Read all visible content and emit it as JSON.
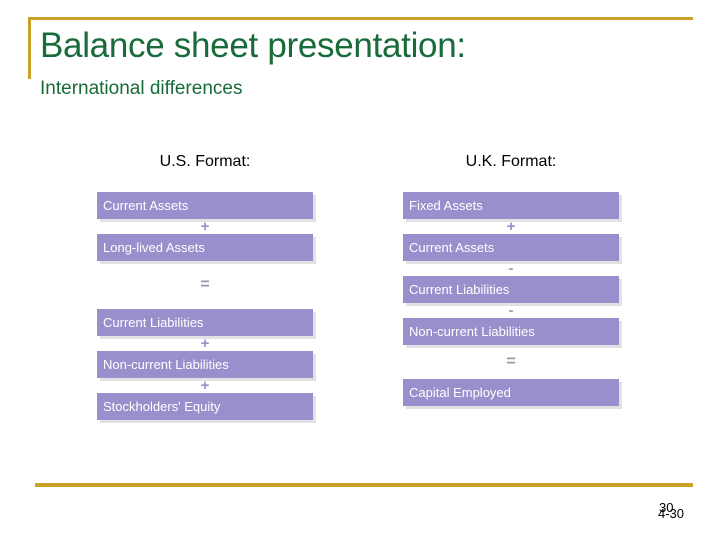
{
  "slide": {
    "title": "Balance sheet presentation:",
    "subtitle": "International differences",
    "accent_gold": "#C9A227",
    "title_green": "#186B3A",
    "bar_purple": "#9A8FCC",
    "bar_text_color": "#FFFFFF"
  },
  "columns": [
    {
      "heading": "U.S. Format:",
      "rows": [
        {
          "kind": "bar",
          "label": "Current Assets"
        },
        {
          "kind": "operator",
          "symbol": "+"
        },
        {
          "kind": "bar",
          "label": "Long-lived Assets"
        },
        {
          "kind": "operator",
          "symbol": "="
        },
        {
          "kind": "bar",
          "label": "Current Liabilities"
        },
        {
          "kind": "operator",
          "symbol": "+"
        },
        {
          "kind": "bar",
          "label": "Non-current Liabilities"
        },
        {
          "kind": "operator",
          "symbol": "+"
        },
        {
          "kind": "bar",
          "label": "Stockholders' Equity"
        }
      ]
    },
    {
      "heading": "U.K. Format:",
      "rows": [
        {
          "kind": "bar",
          "label": "Fixed Assets"
        },
        {
          "kind": "operator",
          "symbol": "+"
        },
        {
          "kind": "bar",
          "label": "Current Assets"
        },
        {
          "kind": "operator",
          "symbol": "-"
        },
        {
          "kind": "bar",
          "label": "Current Liabilities"
        },
        {
          "kind": "operator",
          "symbol": "-"
        },
        {
          "kind": "bar",
          "label": "Non-current Liabilities"
        },
        {
          "kind": "operator",
          "symbol": "="
        },
        {
          "kind": "bar",
          "label": "Capital Employed"
        }
      ]
    }
  ],
  "footer": {
    "page_number_primary": "30",
    "page_number_secondary": "4-30"
  }
}
